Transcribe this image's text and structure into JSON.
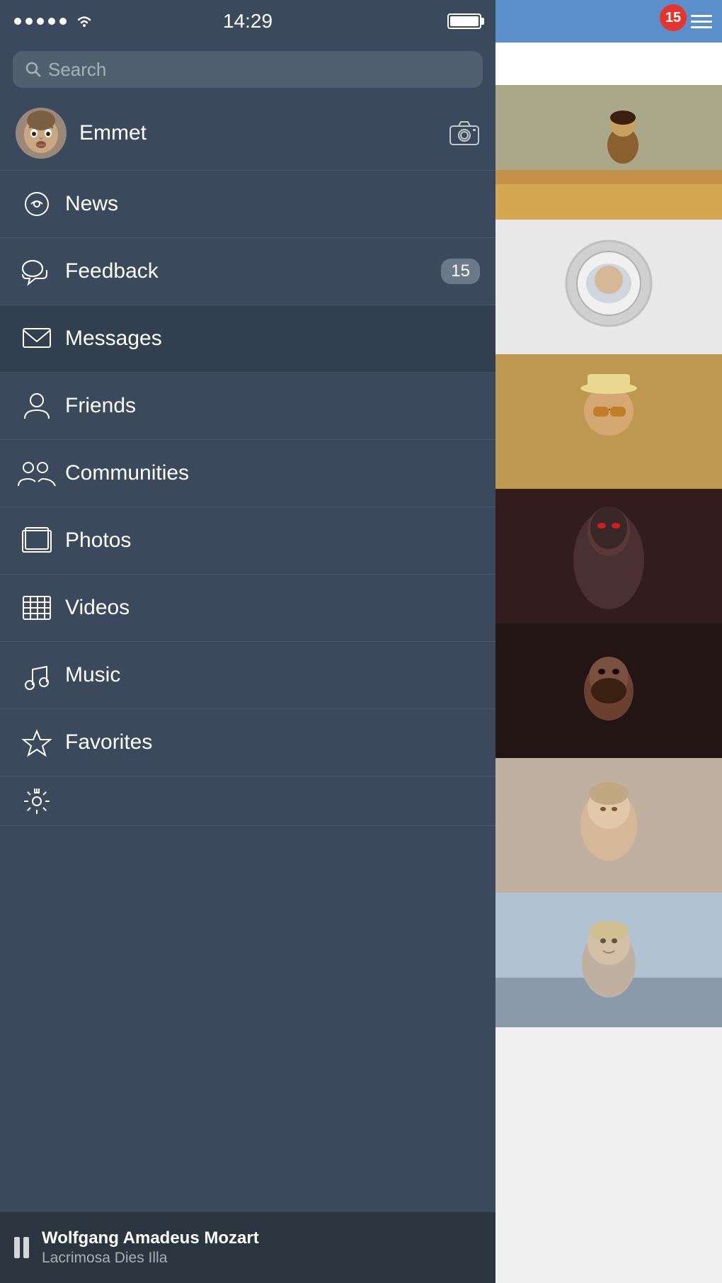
{
  "statusBar": {
    "time": "14:29"
  },
  "search": {
    "placeholder": "Search"
  },
  "profile": {
    "name": "Emmet"
  },
  "menuItems": [
    {
      "id": "news",
      "label": "News",
      "icon": "chat",
      "badge": null
    },
    {
      "id": "feedback",
      "label": "Feedback",
      "icon": "chat-bubble",
      "badge": "15"
    },
    {
      "id": "messages",
      "label": "Messages",
      "icon": "envelope",
      "badge": null,
      "active": true
    },
    {
      "id": "friends",
      "label": "Friends",
      "icon": "person",
      "badge": null
    },
    {
      "id": "communities",
      "label": "Communities",
      "icon": "people",
      "badge": null
    },
    {
      "id": "photos",
      "label": "Photos",
      "icon": "photos",
      "badge": null
    },
    {
      "id": "videos",
      "label": "Videos",
      "icon": "film",
      "badge": null
    },
    {
      "id": "music",
      "label": "Music",
      "icon": "music-note",
      "badge": null
    },
    {
      "id": "favorites",
      "label": "Favorites",
      "icon": "star",
      "badge": null
    }
  ],
  "musicPlayer": {
    "title": "Wolfgang Amadeus Mozart",
    "subtitle": "Lacrimosa Dies Illa"
  },
  "rightPanel": {
    "notificationCount": "15"
  }
}
